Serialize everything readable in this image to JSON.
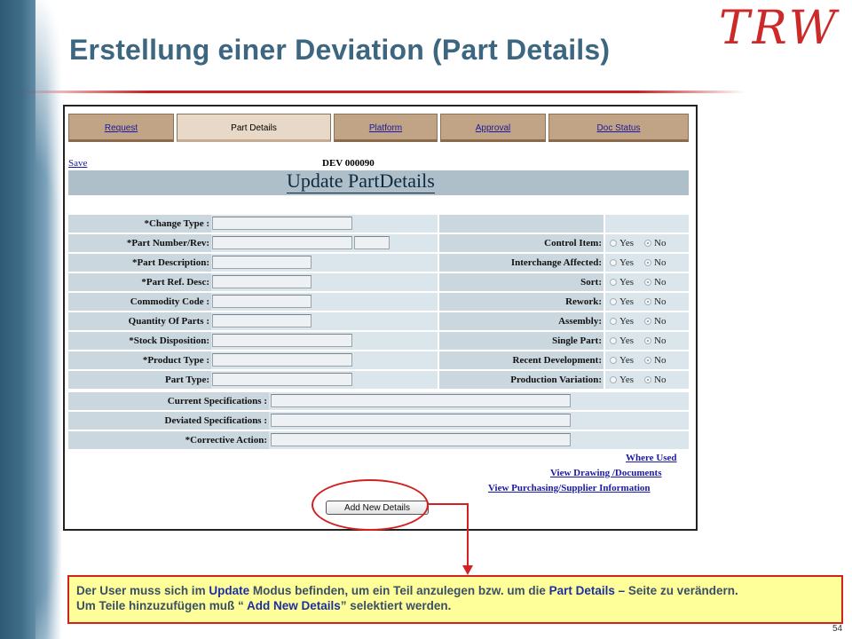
{
  "slide": {
    "title": "Erstellung einer Deviation (Part Details)",
    "logo": "TRW",
    "page_number": "54"
  },
  "tabs": [
    {
      "label": "Request",
      "active": false
    },
    {
      "label": "Part Details",
      "active": true
    },
    {
      "label": "Platform",
      "active": false
    },
    {
      "label": "Approval",
      "active": false
    },
    {
      "label": "Doc Status",
      "active": false
    }
  ],
  "form": {
    "save_link": "Save",
    "deviation_number": "DEV 000090",
    "heading": "Update PartDetails",
    "left_fields": [
      {
        "label": "*Change Type :"
      },
      {
        "label": "*Part Number/Rev:"
      },
      {
        "label": "*Part Description:"
      },
      {
        "label": "*Part Ref. Desc:"
      },
      {
        "label": "Commodity Code :"
      },
      {
        "label": "Quantity Of Parts :"
      },
      {
        "label": "*Stock Disposition:"
      },
      {
        "label": "*Product Type :"
      },
      {
        "label": "Part Type:"
      }
    ],
    "right_fields": [
      {
        "label": "Control Item:",
        "selected": "No"
      },
      {
        "label": "Interchange Affected:",
        "selected": "No"
      },
      {
        "label": "Sort:",
        "selected": "No"
      },
      {
        "label": "Rework:",
        "selected": "No"
      },
      {
        "label": "Assembly:",
        "selected": "No"
      },
      {
        "label": "Single Part:",
        "selected": "No"
      },
      {
        "label": "Recent Development:",
        "selected": "No"
      },
      {
        "label": "Production Variation:",
        "selected": "No"
      }
    ],
    "radio_yes": "Yes",
    "radio_no": "No",
    "spec_fields": [
      {
        "label": "Current Specifications :"
      },
      {
        "label": "Deviated Specifications :"
      },
      {
        "label": "*Corrective Action:"
      }
    ],
    "links": [
      "Where Used",
      "View Drawing /Documents",
      "View Purchasing/Supplier Information"
    ],
    "add_button": "Add New Details"
  },
  "callout": {
    "line1_a": "Der User muss sich im ",
    "line1_b": "Update",
    "line1_c": " Modus befinden, um ein Teil anzulegen bzw. um die ",
    "line1_d": "Part Details –",
    "line1_e": " Seite zu verändern.",
    "line2_a": "Um Teile hinzuzufügen muß “",
    "line2_b": " Add New Details",
    "line2_c": "”  selektiert werden."
  },
  "colors": {
    "title": "#3d6680",
    "accent_red": "#d42020",
    "tab_bg": "#c1a385",
    "form_label_bg": "#cad7de",
    "callout_bg": "#ffff99"
  }
}
